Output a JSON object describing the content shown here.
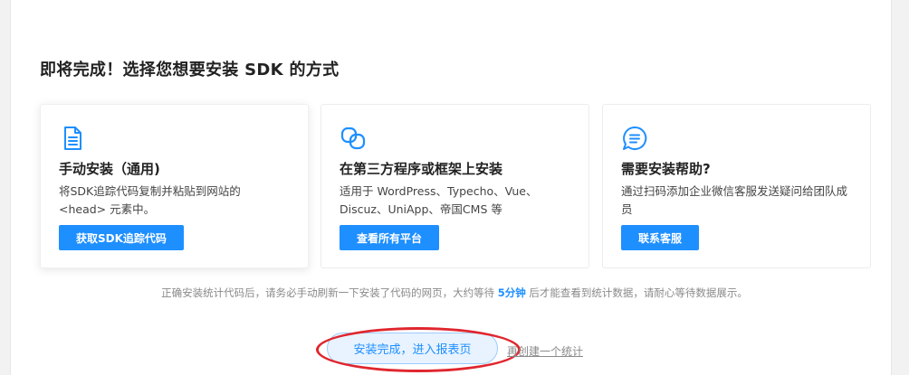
{
  "page": {
    "title": "即将完成！选择您想要安装 SDK 的方式"
  },
  "cards": [
    {
      "icon": "document-icon",
      "title": "手动安装（通用)",
      "description": "将SDK追踪代码复制并粘贴到网站的 <head> 元素中。",
      "button_label": "获取SDK追踪代码"
    },
    {
      "icon": "link-icon",
      "title": "在第三方程序或框架上安装",
      "description": "适用于 WordPress、Typecho、Vue、Discuz、UniApp、帝国CMS 等",
      "button_label": "查看所有平台"
    },
    {
      "icon": "chat-bubble-icon",
      "title": "需要安装帮助?",
      "description": "通过扫码添加企业微信客服发送疑问给团队成员",
      "button_label": "联系客服"
    }
  ],
  "notice": {
    "before": "正确安装统计代码后，请务必手动刷新一下安装了代码的网页，大约等待",
    "highlight": "5分钟",
    "after": "后才能查看到统计数据，请耐心等待数据展示。"
  },
  "actions": {
    "finish_label": "安装完成，进入报表页",
    "create_label": "再创建一个统计"
  },
  "colors": {
    "accent": "#1e8fff",
    "annotation_circle": "#e0262e"
  }
}
